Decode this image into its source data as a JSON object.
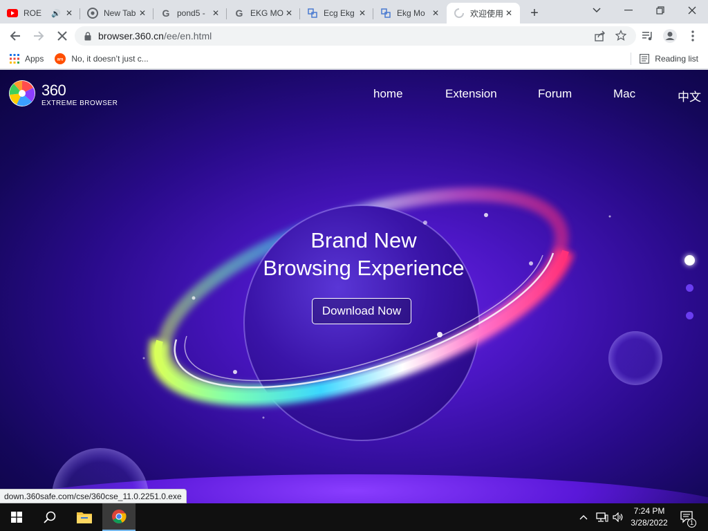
{
  "browser": {
    "tabs": [
      {
        "title": "ROE",
        "icon": "youtube-icon",
        "audio": true
      },
      {
        "title": "New Tab",
        "icon": "chrome-icon"
      },
      {
        "title": "pond5 -",
        "icon": "google-icon"
      },
      {
        "title": "EKG MO",
        "icon": "google-icon"
      },
      {
        "title": "Ecg Ekg",
        "icon": "site-icon"
      },
      {
        "title": "Ekg Mo",
        "icon": "site-icon"
      },
      {
        "title": "欢迎使用",
        "icon": "loading-spinner-icon",
        "active": true
      }
    ],
    "new_tab_label": "+",
    "url": {
      "host": "browser.360.cn",
      "path": "/ee/en.html"
    },
    "bookmarks": [
      {
        "label": "Apps",
        "icon": "apps-grid-icon"
      },
      {
        "label": "No, it doesn’t just c...",
        "icon": "ars-icon"
      }
    ],
    "reading_list_label": "Reading list",
    "status_url": "down.360safe.com/cse/360cse_11.0.2251.0.exe"
  },
  "page": {
    "brand": {
      "number": "360",
      "subtitle": "EXTREME BROWSER"
    },
    "nav": [
      {
        "label": "home"
      },
      {
        "label": "Extension"
      },
      {
        "label": "Forum"
      },
      {
        "label": "Mac"
      },
      {
        "label": "中文"
      }
    ],
    "hero": {
      "line1": "Brand New",
      "line2": "Browsing Experience"
    },
    "download_label": "Download Now",
    "slide_count": 3,
    "active_slide": 1
  },
  "taskbar": {
    "time": "7:24 PM",
    "date": "3/28/2022",
    "notification_count": "1"
  },
  "colors": {
    "page_bg": "#2a0b8c",
    "accent_purple": "#6a22e8",
    "ring_pink": "#ff3d8a",
    "ring_cyan": "#3ad6ff",
    "ring_green": "#9dff6a"
  }
}
